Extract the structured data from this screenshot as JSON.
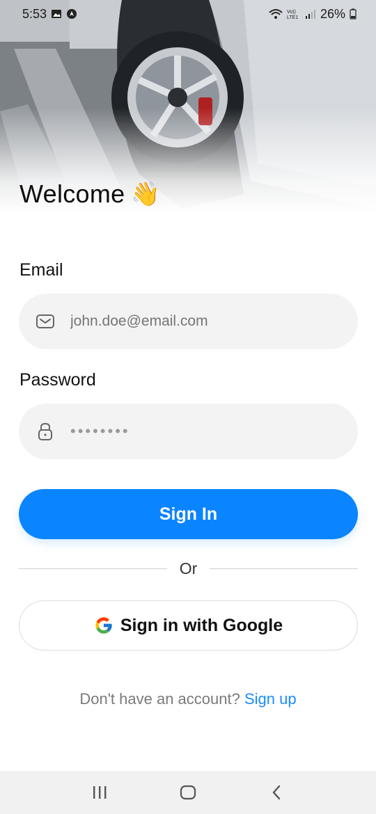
{
  "status_bar": {
    "time": "5:53",
    "battery_percent": "26%",
    "icons": [
      "gallery-icon",
      "app-notification-icon",
      "wifi-icon",
      "volte-icon",
      "signal-icon",
      "battery-icon"
    ]
  },
  "hero": {
    "title": "Welcome",
    "emoji": "👋"
  },
  "form": {
    "email": {
      "label": "Email",
      "placeholder": "john.doe@email.com",
      "icon": "mail-icon"
    },
    "password": {
      "label": "Password",
      "masked_value": "••••••••",
      "icon": "lock-icon"
    }
  },
  "actions": {
    "sign_in": "Sign In",
    "or": "Or",
    "google": "Sign in with Google"
  },
  "footer": {
    "prompt": "Don't have an account?",
    "link": "Sign up"
  },
  "colors": {
    "primary": "#0a84ff",
    "link": "#1a8cff",
    "field_bg": "#f3f3f3"
  },
  "navbar": [
    "recent-apps-icon",
    "home-icon",
    "back-icon"
  ]
}
